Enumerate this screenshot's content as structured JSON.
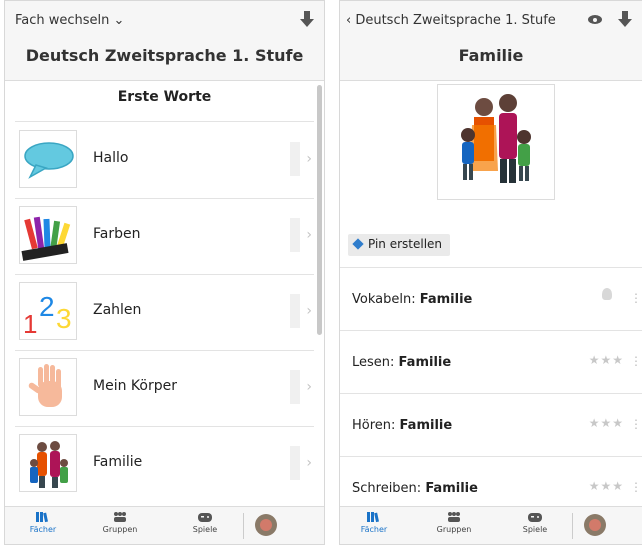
{
  "left": {
    "top_link": "Fach wechseln ⌄",
    "title": "Deutsch Zweitsprache 1. Stufe",
    "section_title": "Erste Worte",
    "items": [
      {
        "label": "Hallo"
      },
      {
        "label": "Farben"
      },
      {
        "label": "Zahlen"
      },
      {
        "label": "Mein Körper"
      },
      {
        "label": "Familie"
      }
    ],
    "zahlen_digits": [
      "1",
      "2",
      "3"
    ]
  },
  "right": {
    "back_link": "‹ Deutsch Zweitsprache 1. Stufe",
    "title": "Familie",
    "pin_label": "Pin erstellen",
    "activities": [
      {
        "prefix": "Vokabeln: ",
        "topic": "Familie"
      },
      {
        "prefix": "Lesen: ",
        "topic": "Familie",
        "stars": "★★★"
      },
      {
        "prefix": "Hören: ",
        "topic": "Familie",
        "stars": "★★★"
      },
      {
        "prefix": "Schreiben: ",
        "topic": "Familie",
        "stars": "★★★"
      }
    ],
    "dots": "⋮"
  },
  "tabbar": {
    "tabs": [
      {
        "label": "Fächer"
      },
      {
        "label": "Gruppen"
      },
      {
        "label": "Spiele"
      }
    ]
  },
  "colors": {
    "accent": "#1a73c8",
    "star": "#c8c8c8",
    "pin": "#2f7dcc"
  },
  "chevron": "›"
}
